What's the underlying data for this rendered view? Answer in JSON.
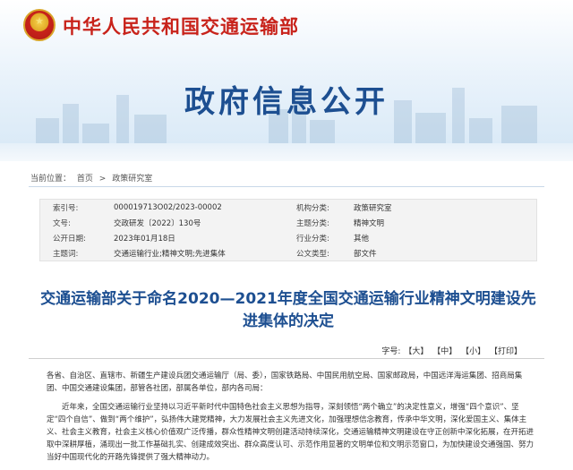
{
  "header": {
    "ministry_name": "中华人民共和国交通运输部",
    "banner_title": "政府信息公开"
  },
  "breadcrumb": {
    "label": "当前位置：",
    "home": "首页",
    "separator": ">",
    "current": "政策研究室"
  },
  "info": {
    "rows": [
      {
        "k1": "索引号:",
        "v1": "000019713O02/2023-00002",
        "k2": "机构分类:",
        "v2": "政策研究室"
      },
      {
        "k1": "文号:",
        "v1": "交政研发〔2022〕130号",
        "k2": "主题分类:",
        "v2": "精神文明"
      },
      {
        "k1": "公开日期:",
        "v1": "2023年01月18日",
        "k2": "行业分类:",
        "v2": "其他"
      },
      {
        "k1": "主题词:",
        "v1": "交通运输行业;精神文明;先进集体",
        "k2": "公文类型:",
        "v2": "部文件"
      }
    ]
  },
  "article": {
    "title": "交通运输部关于命名2020—2021年度全国交通运输行业精神文明建设先进集体的决定",
    "font_size_label": "字号:",
    "size_large": "【大】",
    "size_medium": "【中】",
    "size_small": "【小】",
    "print": "【打印】",
    "paragraph1": "各省、自治区、直辖市、新疆生产建设兵团交通运输厅（局、委），国家铁路局、中国民用航空局、国家邮政局，中国远洋海运集团、招商局集团、中国交通建设集团，部管各社团，部属各单位，部内各司局：",
    "paragraph2": "近年来，全国交通运输行业坚持以习近平新时代中国特色社会主义思想为指导，深刻领悟“两个确立”的决定性意义，增强“四个意识”、坚定“四个自信”、做到“两个维护”，弘扬伟大建党精神，大力发展社会主义先进文化，加强理想信念教育，传承中华文明，深化爱国主义、集体主义、社会主义教育，社会主义核心价值观广泛传播，群众性精神文明创建活动持续深化，交通运输精神文明建设在守正创新中深化拓展，在开拓进取中深耕厚植，涌现出一批工作基础扎实、创建成效突出、群众高度认可、示范作用显著的文明单位和文明示范窗口，为加快建设交通强国、努力当好中国现代化的开路先锋提供了强大精神动力。"
  },
  "colors": {
    "ministry_red": "#c8231b",
    "title_blue": "#1d4f91"
  }
}
